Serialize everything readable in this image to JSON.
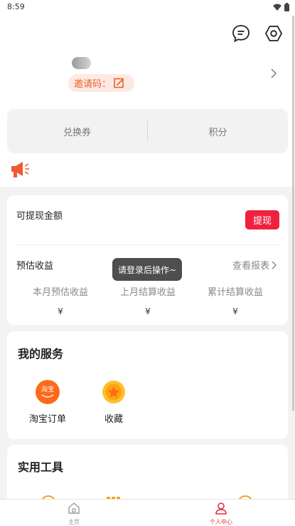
{
  "status": {
    "time": "8:59"
  },
  "header": {
    "invite_label": "邀请码：",
    "colors": {
      "invite_bg": "#fde9e3",
      "invite_text": "#e8622e"
    }
  },
  "exchange": {
    "voucher_label": "兑换券",
    "points_label": "积分"
  },
  "earnings": {
    "withdrawable_label": "可提现金额",
    "withdraw_button": "提现",
    "estimate_label": "预估收益",
    "report_link": "查看报表",
    "stats": [
      {
        "title": "本月预估收益",
        "value": "¥"
      },
      {
        "title": "上月结算收益",
        "value": "¥"
      },
      {
        "title": "累计结算收益",
        "value": "¥"
      }
    ],
    "colors": {
      "withdraw_bg": "#f0213f"
    }
  },
  "toast": {
    "text": "请登录后操作~"
  },
  "services": {
    "title": "我的服务",
    "items": [
      {
        "label": "淘宝订单",
        "icon": "taobao-icon",
        "badge": "淘宝"
      },
      {
        "label": "收藏",
        "icon": "favorite-star-icon"
      }
    ]
  },
  "tools": {
    "title": "实用工具"
  },
  "tabbar": {
    "tabs": [
      {
        "label": "主页",
        "icon": "home-icon",
        "active": false
      },
      {
        "label": "个人中心",
        "icon": "person-icon",
        "active": true
      }
    ],
    "colors": {
      "active": "#e8283c",
      "inactive": "#999999"
    }
  }
}
